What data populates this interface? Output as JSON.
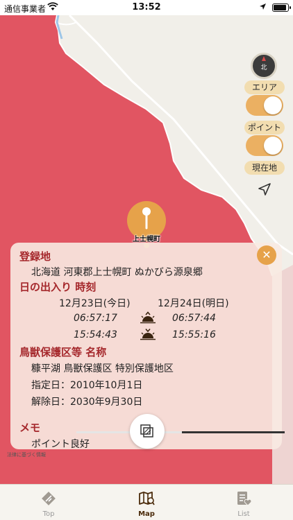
{
  "status_bar": {
    "carrier": "通信事業者",
    "time": "13:52"
  },
  "map": {
    "controls": {
      "area_label": "エリア",
      "point_label": "ポイント",
      "current_location_label": "現在地",
      "compass_label": "北"
    },
    "pin_label": "上士幌町",
    "legal_text": "法律に基づく情報"
  },
  "panel": {
    "registered_heading": "登録地",
    "registered_value": "北海道 河東郡上士幌町 ぬかびら源泉郷",
    "sun_heading": "日の出入り 時刻",
    "today_label": "12月23日(今日)",
    "tomorrow_label": "12月24日(明日)",
    "sunrise_today": "06:57:17",
    "sunrise_tomorrow": "06:57:44",
    "sunset_today": "15:54:43",
    "sunset_tomorrow": "15:55:16",
    "protection_heading": "鳥獣保護区等 名称",
    "protection_name": "糠平湖 鳥獣保護区 特別保護地区",
    "designated_date": "指定日：2010年10月1日",
    "release_date": "解除日：2030年9月30日",
    "memo_heading": "メモ",
    "memo_value": "ポイント良好",
    "close_icon": "close-icon"
  },
  "tabs": [
    {
      "label": "Top",
      "icon": "diamond-tool-icon",
      "active": false
    },
    {
      "label": "Map",
      "icon": "map-pin-icon",
      "active": true
    },
    {
      "label": "List",
      "icon": "list-heart-icon",
      "active": false
    }
  ],
  "colors": {
    "area_fill": "#e15562",
    "accent": "#e6a24a",
    "heading": "#a5282c"
  }
}
